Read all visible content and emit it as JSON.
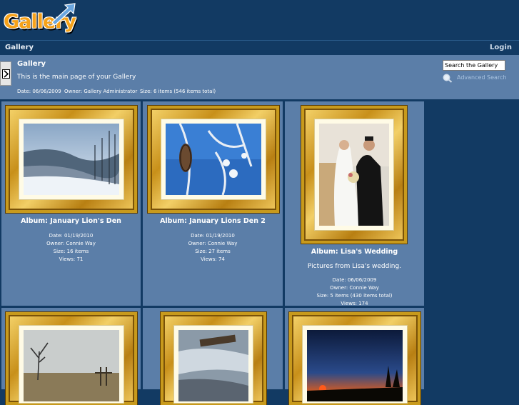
{
  "logo": {
    "text": "Gallery"
  },
  "nav": {
    "breadcrumb": "Gallery",
    "login": "Login"
  },
  "info": {
    "title": "Gallery",
    "description": "This is the main page of your Gallery",
    "date": "Date: 06/06/2009",
    "owner": "Owner: Gallery Administrator",
    "size": "Size: 6 items (546 items total)"
  },
  "search": {
    "value": "Search the Gallery",
    "advanced": "Advanced Search"
  },
  "albums": [
    {
      "title": "Album: January Lion's Den",
      "date": "Date: 01/19/2010",
      "owner": "Owner: Connie Way",
      "size": "Size: 16 items",
      "views": "Views: 71",
      "photo_icon": "snowy-forest-valley"
    },
    {
      "title": "Album: January Lions Den 2",
      "date": "Date: 01/19/2010",
      "owner": "Owner: Connie Way",
      "size": "Size: 27 items",
      "views": "Views: 74",
      "photo_icon": "frosted-pine-cones"
    },
    {
      "title": "Album: Lisa's Wedding",
      "description": "Pictures from Lisa's wedding.",
      "date": "Date: 06/06/2009",
      "owner": "Owner: Connie Way",
      "size": "Size: 5 items (430 items total)",
      "views": "Views: 174",
      "photo_icon": "wedding-couple"
    },
    {
      "photo_icon": "foggy-field-tree"
    },
    {
      "photo_icon": "frozen-creek"
    },
    {
      "photo_icon": "sunset-horizon"
    }
  ],
  "colors": {
    "background": "#123a63",
    "panel": "#5b7ea8",
    "gold": "#c89a1c"
  }
}
